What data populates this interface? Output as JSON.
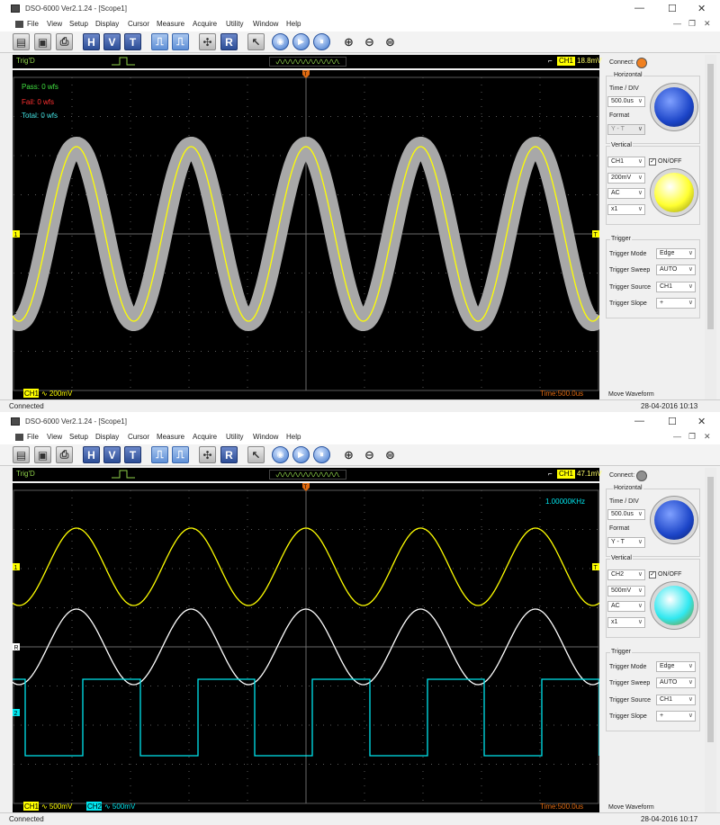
{
  "windows": [
    {
      "title": "DSO-6000 Ver2.1.24 - [Scope1]",
      "menu": [
        "File",
        "View",
        "Setup",
        "Display",
        "Cursor",
        "Measure",
        "Acquire",
        "Utility",
        "Window",
        "Help"
      ],
      "toolbar_glyphs": {
        "h": "H",
        "v": "V",
        "t": "T",
        "r": "R"
      },
      "status_strip": {
        "trig_state": "Trig'D",
        "trig_channel": "CH1",
        "trig_value": "18.8mV",
        "trig_marker": "T"
      },
      "overlay": {
        "pass": "Pass: 0 wfs",
        "fail": "Fail: 0 wfs",
        "total": "Total: 0 wfs"
      },
      "footer": {
        "ch_badges": [
          {
            "label": "CH1",
            "value": "∿ 200mV"
          }
        ],
        "time": "Time:500.0us"
      },
      "panel": {
        "connect_label": "Connect:",
        "connect_color": "#f08020",
        "horizontal_label": "Horizontal",
        "time_div_label": "Time / DIV",
        "time_div_value": "500.0us",
        "format_label": "Format",
        "format_value": "Y - T",
        "vertical_label": "Vertical",
        "channel_value": "CH1",
        "onoff_label": "ON/OFF",
        "volts_value": "200mV",
        "coupling_value": "AC",
        "probe_value": "x1",
        "trigger_label": "Trigger",
        "trigger_mode_label": "Trigger Mode",
        "trigger_mode_value": "Edge",
        "trigger_sweep_label": "Trigger Sweep",
        "trigger_sweep_value": "AUTO",
        "trigger_source_label": "Trigger Source",
        "trigger_source_value": "CH1",
        "trigger_slope_label": "Trigger Slope",
        "trigger_slope_value": "+",
        "move_waveform_label": "Move Waveform",
        "volt_knob_color": "#ffff30",
        "time_knob_color": "#1c45c8"
      },
      "status": {
        "left": "Connected",
        "right": "28-04-2016  10:13"
      }
    },
    {
      "title": "DSO-6000 Ver2.1.24 - [Scope1]",
      "menu": [
        "File",
        "View",
        "Setup",
        "Display",
        "Cursor",
        "Measure",
        "Acquire",
        "Utility",
        "Window",
        "Help"
      ],
      "toolbar_glyphs": {
        "h": "H",
        "v": "V",
        "t": "T",
        "r": "R"
      },
      "status_strip": {
        "trig_state": "Trig'D",
        "trig_channel": "CH1",
        "trig_value": "47.1mV",
        "trig_marker": "T"
      },
      "overlay": {
        "freq": "1.00000KHz"
      },
      "footer": {
        "ch_badges": [
          {
            "label": "CH1",
            "value": "∿ 500mV"
          },
          {
            "label": "CH2",
            "value": "∿ 500mV"
          }
        ],
        "time": "Time:500.0us"
      },
      "panel": {
        "connect_label": "Connect:",
        "connect_color": "#909090",
        "horizontal_label": "Horizontal",
        "time_div_label": "Time / DIV",
        "time_div_value": "500.0us",
        "format_label": "Format",
        "format_value": "Y - T",
        "vertical_label": "Vertical",
        "channel_value": "CH2",
        "onoff_label": "ON/OFF",
        "volts_value": "500mV",
        "coupling_value": "AC",
        "probe_value": "x1",
        "trigger_label": "Trigger",
        "trigger_mode_label": "Trigger Mode",
        "trigger_mode_value": "Edge",
        "trigger_sweep_label": "Trigger Sweep",
        "trigger_sweep_value": "AUTO",
        "trigger_source_label": "Trigger Source",
        "trigger_source_value": "CH1",
        "trigger_slope_label": "Trigger Slope",
        "trigger_slope_value": "+",
        "move_waveform_label": "Move Waveform",
        "volt_knob_color": "#30e8f0",
        "time_knob_color": "#1c45c8"
      },
      "status": {
        "left": "Connected",
        "right": "28-04-2016  10:17"
      }
    }
  ],
  "colors": {
    "ch1": "#ffff00",
    "ch2": "#00e5ee",
    "ref": "#ffffff",
    "grid": "#5a5a5a",
    "accent": "#e06a10"
  }
}
